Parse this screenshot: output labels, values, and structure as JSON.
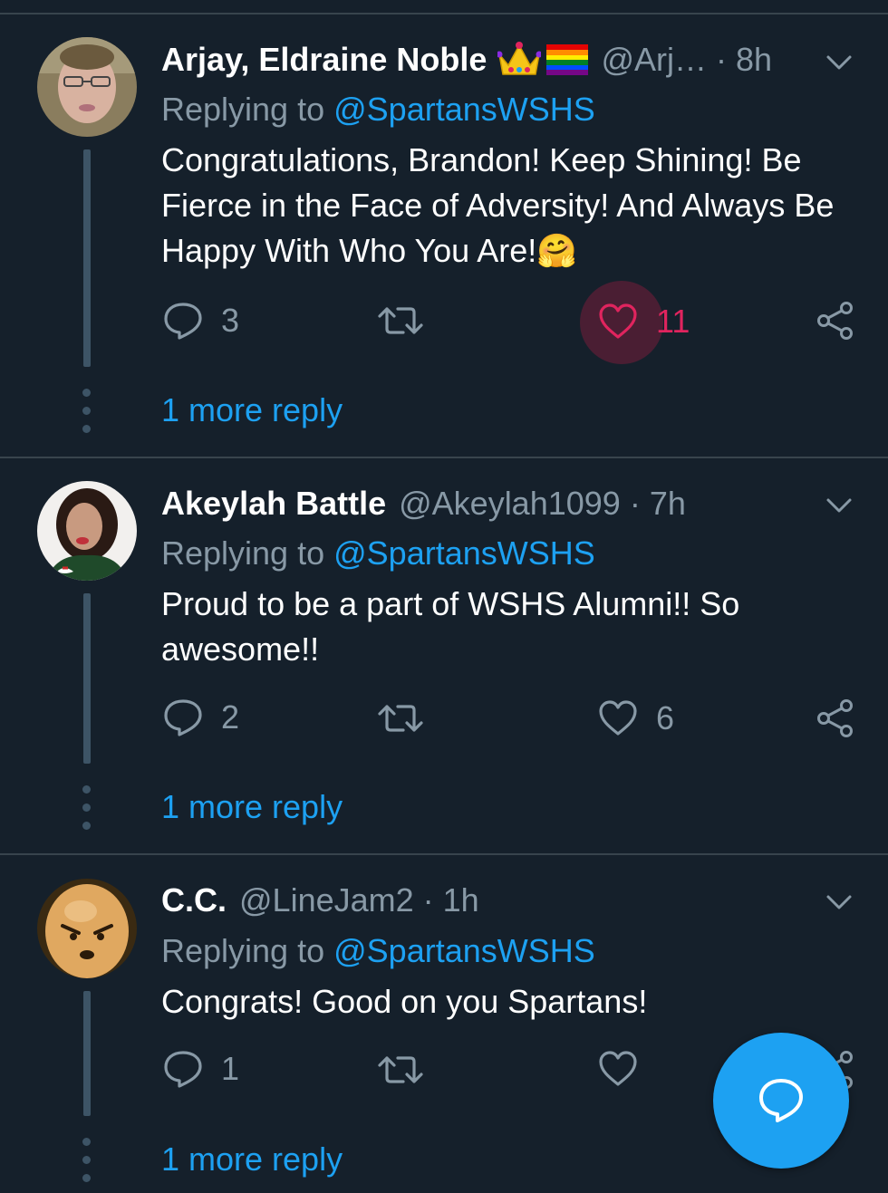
{
  "tweets": [
    {
      "name": "Arjay, Eldraine Noble",
      "badges": [
        "crown-emoji",
        "rainbow-flag-emoji"
      ],
      "handle": "@Arj…",
      "time": "8h",
      "reply_prefix": "Replying to",
      "reply_mention": "@SpartansWSHS",
      "text": "Congratulations, Brandon! Keep Shining! Be Fierce in the Face of Adversity! And Always Be Happy With Who You Are!🤗",
      "reply_count": "3",
      "like_count": "11",
      "liked": true,
      "more_replies": "1 more reply"
    },
    {
      "name": "Akeylah Battle",
      "handle": "@Akeylah1099",
      "time": "7h",
      "reply_prefix": "Replying to",
      "reply_mention": "@SpartansWSHS",
      "text": "Proud to be a part of WSHS Alumni!! So awesome!!",
      "reply_count": "2",
      "like_count": "6",
      "liked": false,
      "more_replies": "1 more reply"
    },
    {
      "name": "C.C.",
      "handle": "@LineJam2",
      "time": "1h",
      "reply_prefix": "Replying to",
      "reply_mention": "@SpartansWSHS",
      "text": "Congrats! Good on you Spartans!",
      "reply_count": "1",
      "like_count": "",
      "liked": false,
      "more_replies": "1 more reply"
    }
  ],
  "separator": "·",
  "colors": {
    "background": "#15202b",
    "accent": "#1da1f2",
    "like_active": "#e0245e",
    "muted": "#8899a6"
  },
  "fab": {
    "icon": "compose-reply-icon"
  }
}
